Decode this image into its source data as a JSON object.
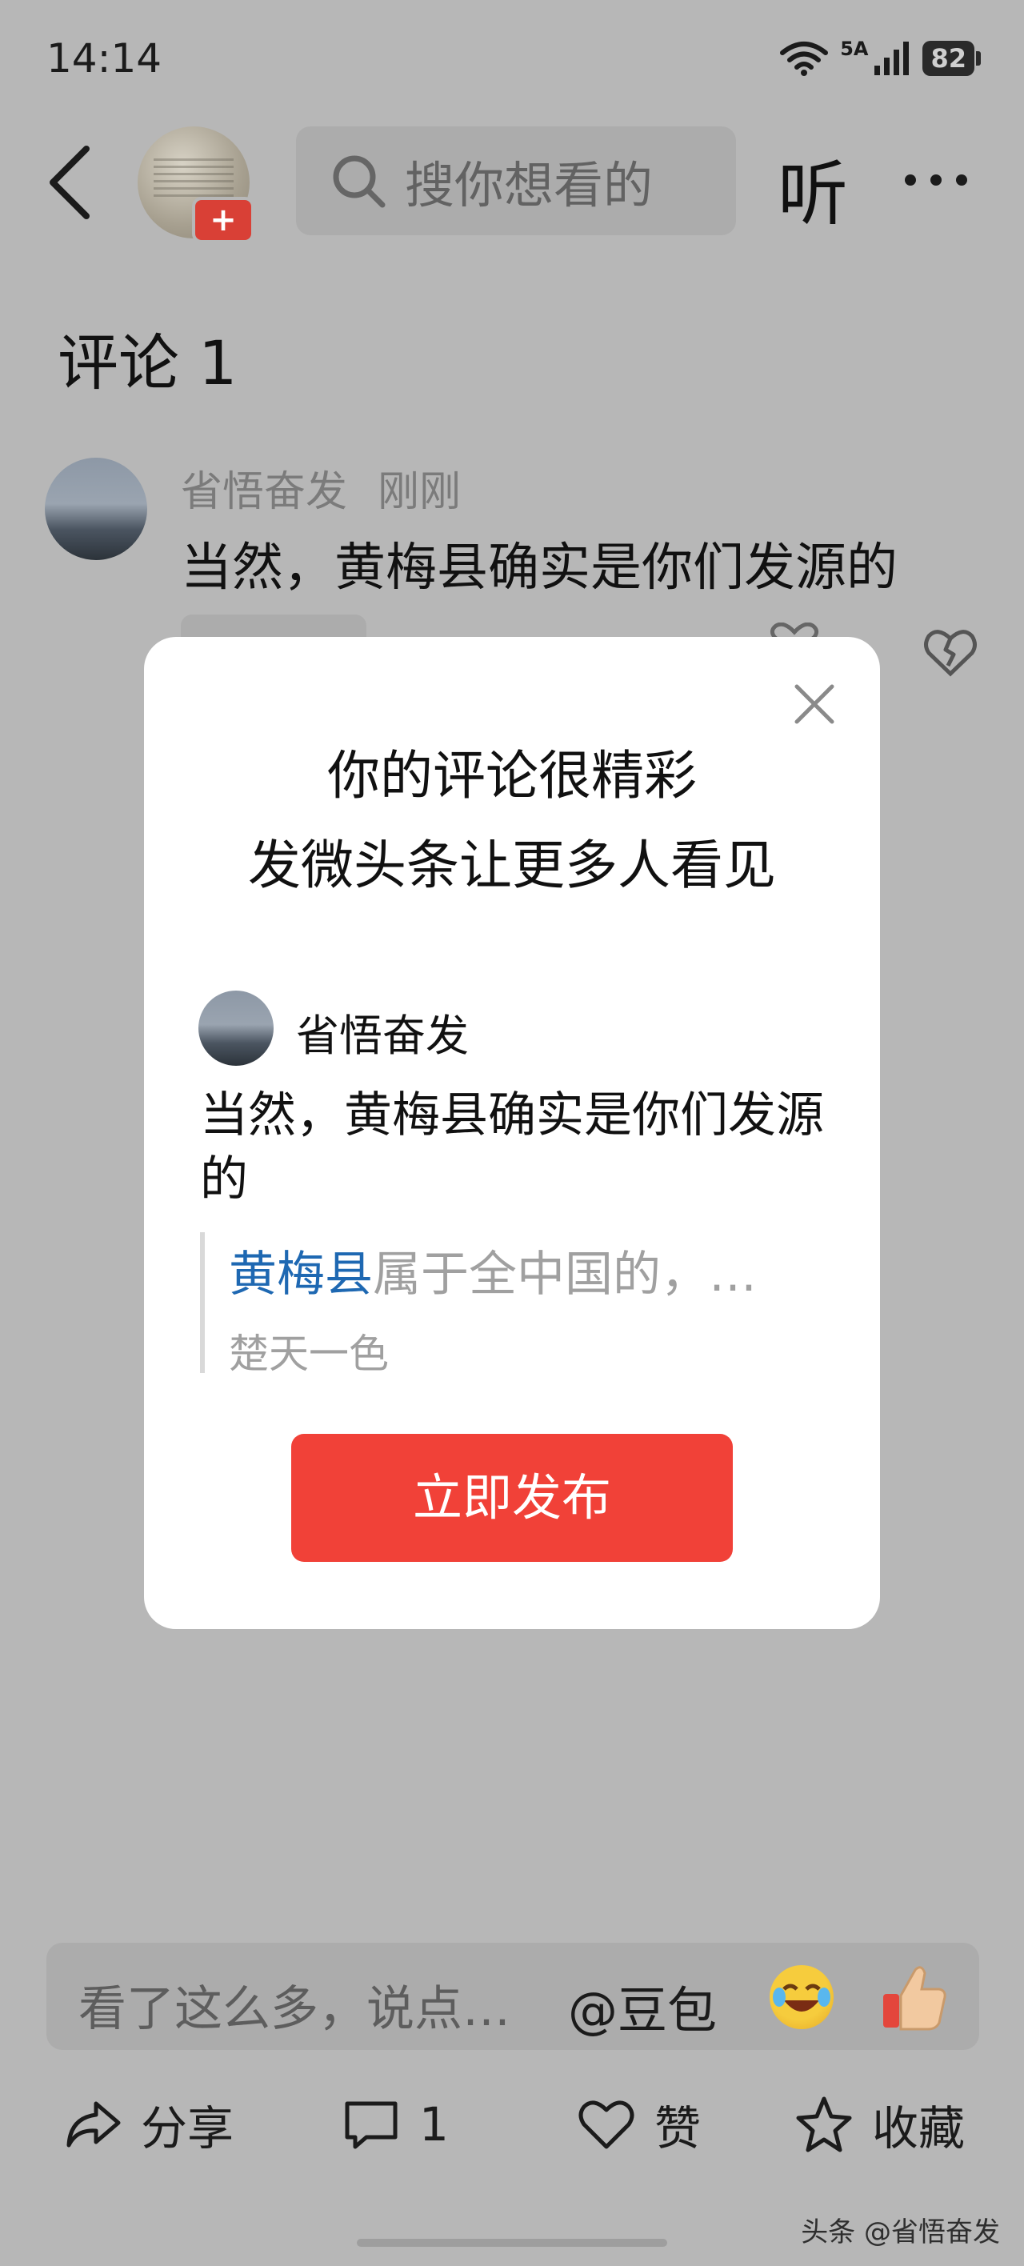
{
  "status_bar": {
    "time": "14:14",
    "network": "5A",
    "battery": "82",
    "icons": [
      "wifi-icon",
      "signal-icon",
      "battery-icon"
    ]
  },
  "header": {
    "search_placeholder": "搜你想看的",
    "listen_label": "听",
    "icons": [
      "back-icon",
      "search-icon",
      "more-icon"
    ]
  },
  "comments": {
    "title": "评论 1",
    "items": [
      {
        "user": "省悟奋发",
        "time": "刚刚",
        "text": "当然，黄梅县确实是你们发源的",
        "like_label": "赞"
      }
    ]
  },
  "modal": {
    "title_line1": "你的评论很精彩",
    "title_line2": "发微头条让更多人看见",
    "card": {
      "user": "省悟奋发",
      "text": "当然，黄梅县确实是你们发源的",
      "quote_highlight": "黄梅县",
      "quote_rest": "属于全中国的，…",
      "quote_author": "楚天一色"
    },
    "publish_label": "立即发布"
  },
  "comment_input": {
    "placeholder": "看了这么多，说点…",
    "mention_label": "@豆包"
  },
  "bottom_bar": {
    "share_label": "分享",
    "comment_count": "1",
    "like_label": "赞",
    "favorite_label": "收藏"
  },
  "watermark": "头条 @省悟奋发",
  "colors": {
    "accent_red": "#f14138",
    "link_blue": "#1e68b2",
    "overlay_gray": "#b7b7b7"
  }
}
